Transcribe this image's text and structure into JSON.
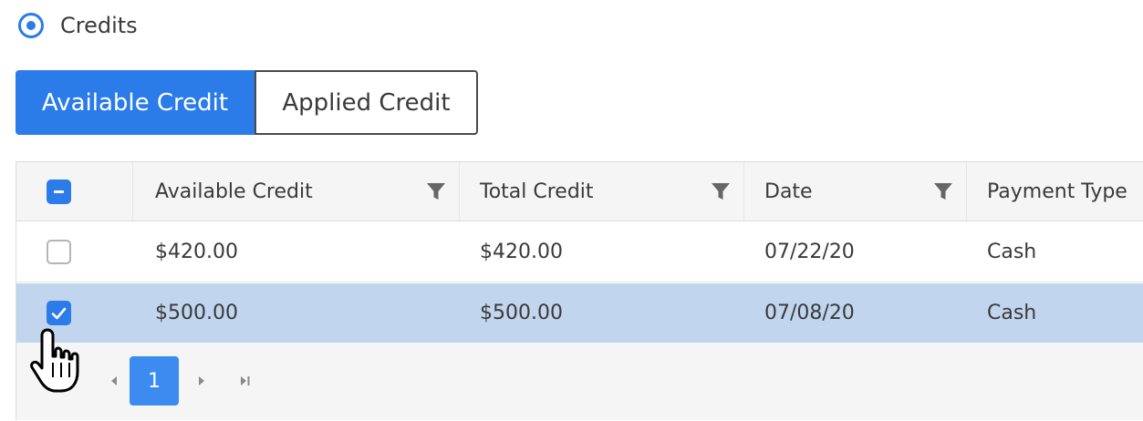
{
  "section": {
    "label": "Credits",
    "selected": true
  },
  "tabs": [
    {
      "label": "Available Credit",
      "active": true
    },
    {
      "label": "Applied Credit",
      "active": false
    }
  ],
  "grid": {
    "columns": [
      "Available Credit",
      "Total Credit",
      "Date",
      "Payment Type"
    ],
    "rows": [
      {
        "available": "$420.00",
        "total": "$420.00",
        "date": "07/22/20",
        "payment": "Cash",
        "checked": false
      },
      {
        "available": "$500.00",
        "total": "$500.00",
        "date": "07/08/20",
        "payment": "Cash",
        "checked": true
      }
    ],
    "pager": {
      "current_page": "1"
    }
  },
  "icons": {
    "radio": "radio-selected-icon",
    "filter": "filter-icon",
    "header_check": "checkbox-indeterminate-icon",
    "row_check": "checkbox-icon",
    "pager_prev": "caret-left-icon",
    "pager_next": "caret-right-icon",
    "pager_last": "last-page-icon",
    "cursor": "hand-pointer-icon"
  },
  "colors": {
    "accent": "#2b7be9",
    "selected_row": "#c2d5ee",
    "header_bg": "#f5f5f5"
  }
}
